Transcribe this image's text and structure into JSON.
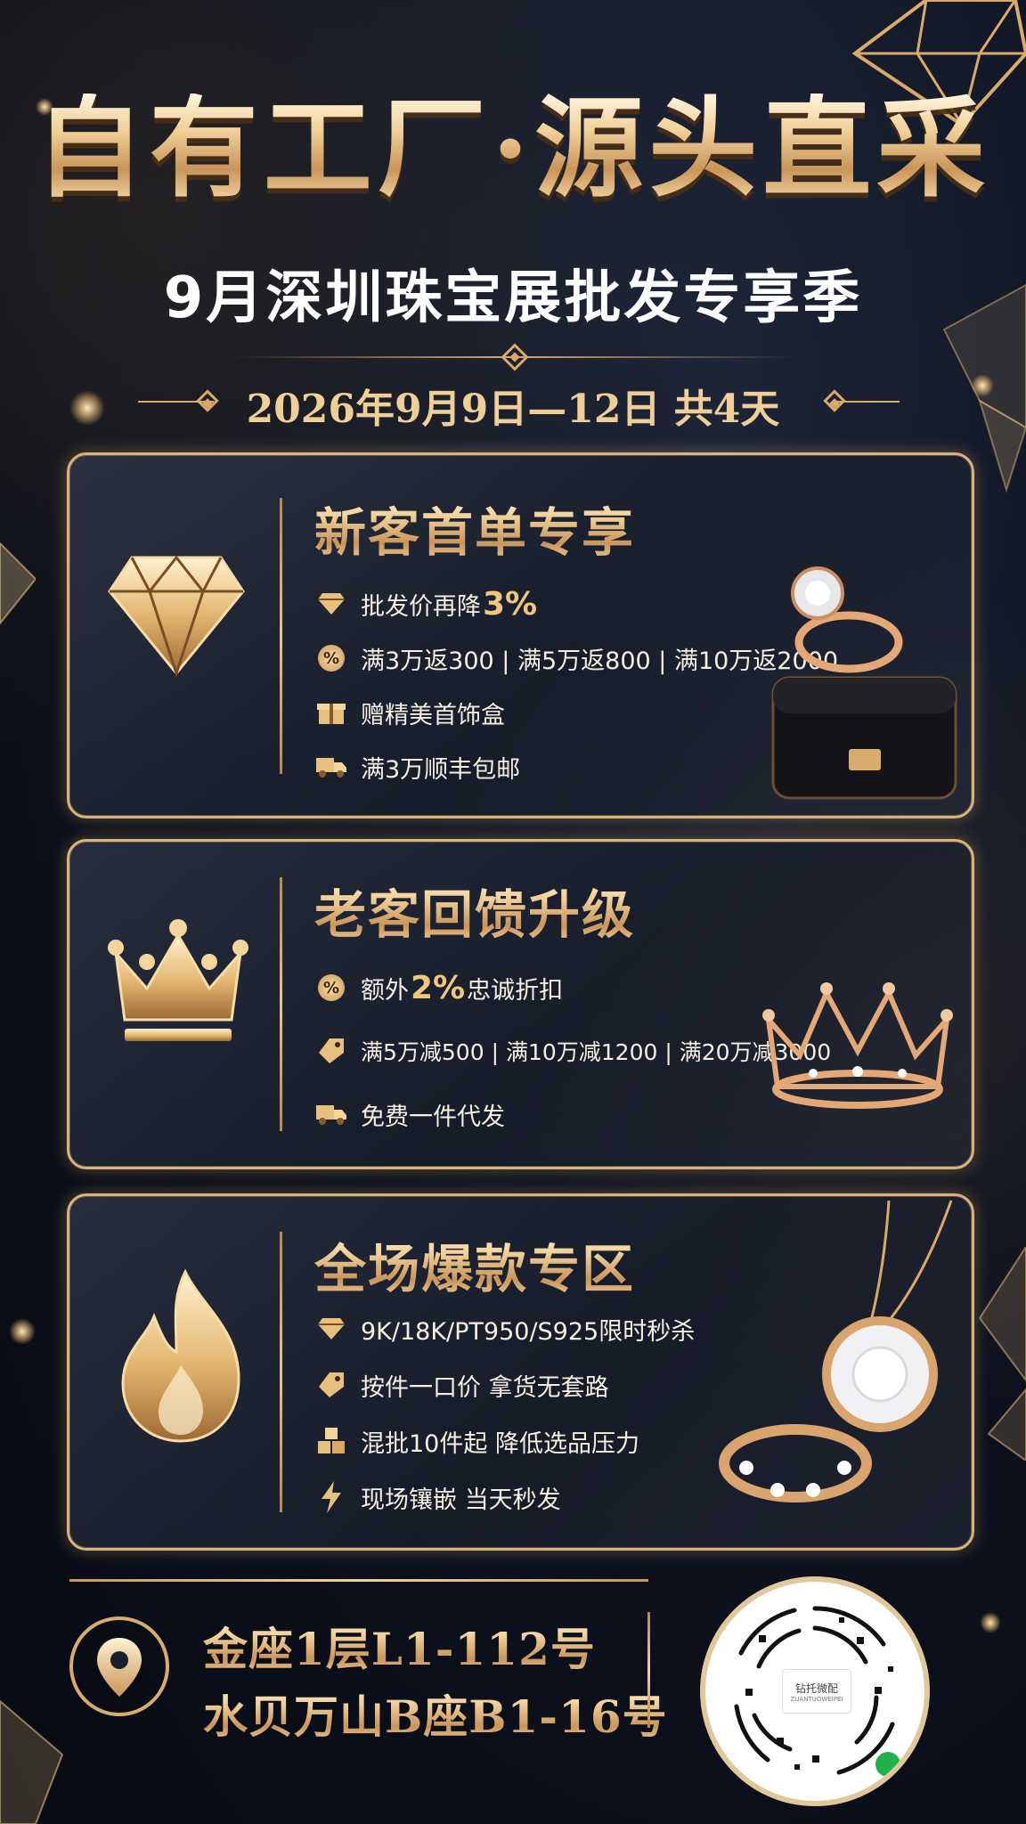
{
  "header": {
    "headline": "自有工厂·源头直采",
    "subline": "9月深圳珠宝展批发专享季",
    "dateline": "2026年9月9日—12日 共4天"
  },
  "cards": [
    {
      "title": "新客首单专享",
      "icon": "diamond-icon",
      "items": [
        {
          "icon": "diamond-small-icon",
          "pre": "批发价再降",
          "big": "3%",
          "post": ""
        },
        {
          "icon": "percent-icon",
          "pre": "满3万返300 | 满5万返800 | 满10万返2000",
          "big": "",
          "post": ""
        },
        {
          "icon": "gift-box-icon",
          "pre": "赠精美首饰盒",
          "big": "",
          "post": ""
        },
        {
          "icon": "delivery-truck-icon",
          "pre": "满3万顺丰包邮",
          "big": "",
          "post": ""
        }
      ]
    },
    {
      "title": "老客回馈升级",
      "icon": "crown-icon",
      "items": [
        {
          "icon": "percent-icon",
          "pre": "额外",
          "big": "2%",
          "post": "忠诚折扣"
        },
        {
          "icon": "price-tag-icon",
          "pre": "满5万减500 | 满10万减1200 | 满20万减3000",
          "big": "",
          "post": ""
        },
        {
          "icon": "delivery-truck-icon",
          "pre": "免费一件代发",
          "big": "",
          "post": ""
        }
      ]
    },
    {
      "title": "全场爆款专区",
      "icon": "flame-icon",
      "items": [
        {
          "icon": "diamond-small-icon",
          "pre": "9K/18K/PT950/S925限时秒杀",
          "big": "",
          "post": ""
        },
        {
          "icon": "price-tag-icon",
          "pre": "按件一口价 拿货无套路",
          "big": "",
          "post": ""
        },
        {
          "icon": "boxes-icon",
          "pre": "混批10件起 降低选品压力",
          "big": "",
          "post": ""
        },
        {
          "icon": "lightning-icon",
          "pre": "现场镶嵌 当天秒发",
          "big": "",
          "post": ""
        }
      ]
    }
  ],
  "footer": {
    "address_line1": "金座1层L1-112号",
    "address_line2": "水贝万山B座B1-16号",
    "qr_center_text": "钻托微配",
    "qr_center_sub": "ZUANTUOWEIPEI"
  },
  "colors": {
    "gold": "#d9b37a",
    "background": "#0e1320",
    "text": "#f6efe2"
  }
}
